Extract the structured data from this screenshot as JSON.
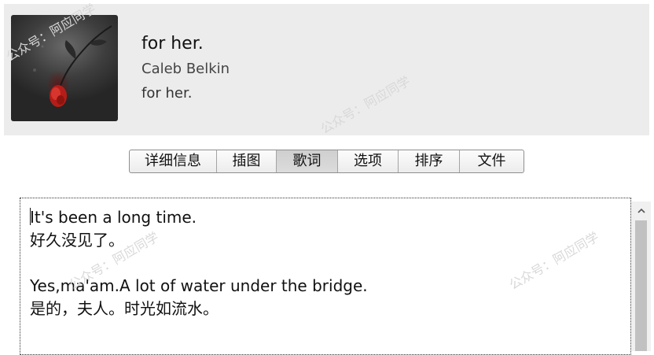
{
  "header": {
    "title": "for her.",
    "artist": "Caleb Belkin",
    "album": "for her."
  },
  "tabs": [
    {
      "label": "详细信息",
      "active": false
    },
    {
      "label": "插图",
      "active": false
    },
    {
      "label": "歌词",
      "active": true
    },
    {
      "label": "选项",
      "active": false
    },
    {
      "label": "排序",
      "active": false
    },
    {
      "label": "文件",
      "active": false
    }
  ],
  "lyrics": {
    "lines": [
      "It's been a long time.",
      "好久没见了。",
      "",
      "Yes,ma'am.A lot of water under the bridge.",
      "是的，夫人。时光如流水。"
    ]
  },
  "watermark": {
    "text": "公众号：阿应同学"
  },
  "colors": {
    "header_bg": "#ececec",
    "active_tab_bg": "#d4d4d4",
    "rose": "#c0201c"
  },
  "icons": {
    "scroll_up": "chevron-up-icon"
  }
}
